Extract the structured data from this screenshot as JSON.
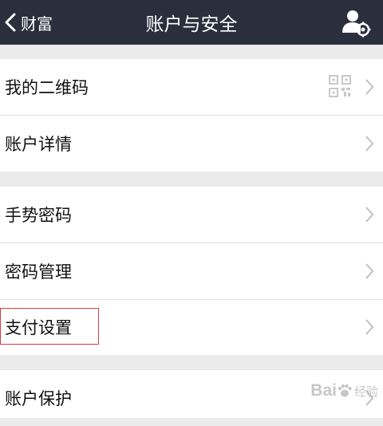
{
  "nav": {
    "back_label": "财富",
    "title": "账户与安全",
    "action_icon": "user-settings-icon"
  },
  "groups": [
    {
      "rows": [
        {
          "label": "我的二维码",
          "icon": "qr-code-icon"
        },
        {
          "label": "账户详情"
        }
      ]
    },
    {
      "rows": [
        {
          "label": "手势密码"
        },
        {
          "label": "密码管理"
        },
        {
          "label": "支付设置"
        }
      ]
    },
    {
      "rows": [
        {
          "label": "账户保护"
        }
      ]
    }
  ],
  "colors": {
    "navbar_bg": "#2b2f3d",
    "page_bg": "#ebebeb",
    "row_bg": "#ffffff",
    "highlight": "#d33d3d"
  },
  "watermark": {
    "brand": "Bai",
    "brand_suffix": "经验"
  }
}
